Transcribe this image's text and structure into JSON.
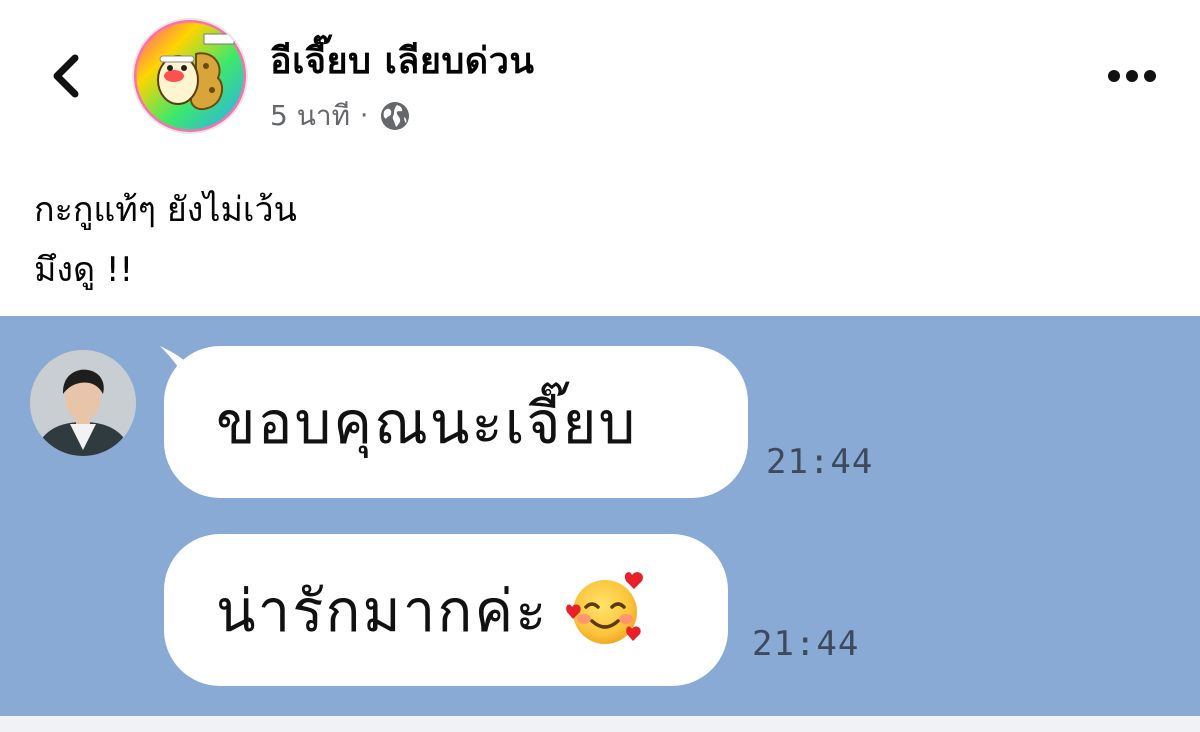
{
  "post": {
    "author": "อีเจี๊ยบ เลียบด่วน",
    "time": "5 นาที",
    "separator": "·",
    "privacy_icon": "globe-icon",
    "caption_lines": [
      "กะกูแท้ๆ ยังไม่เว้น",
      "มึงดู !!"
    ]
  },
  "header": {
    "back_icon": "chevron-left-icon",
    "more_icon": "more-horizontal-icon"
  },
  "chat": {
    "background_color": "#8aaad6",
    "messages": [
      {
        "text": "ขอบคุณนะเจี๊ยบ",
        "time": "21:44"
      },
      {
        "text": "น่ารักมากค่ะ",
        "emoji": "smiling-face-with-hearts",
        "time": "21:44"
      }
    ]
  }
}
